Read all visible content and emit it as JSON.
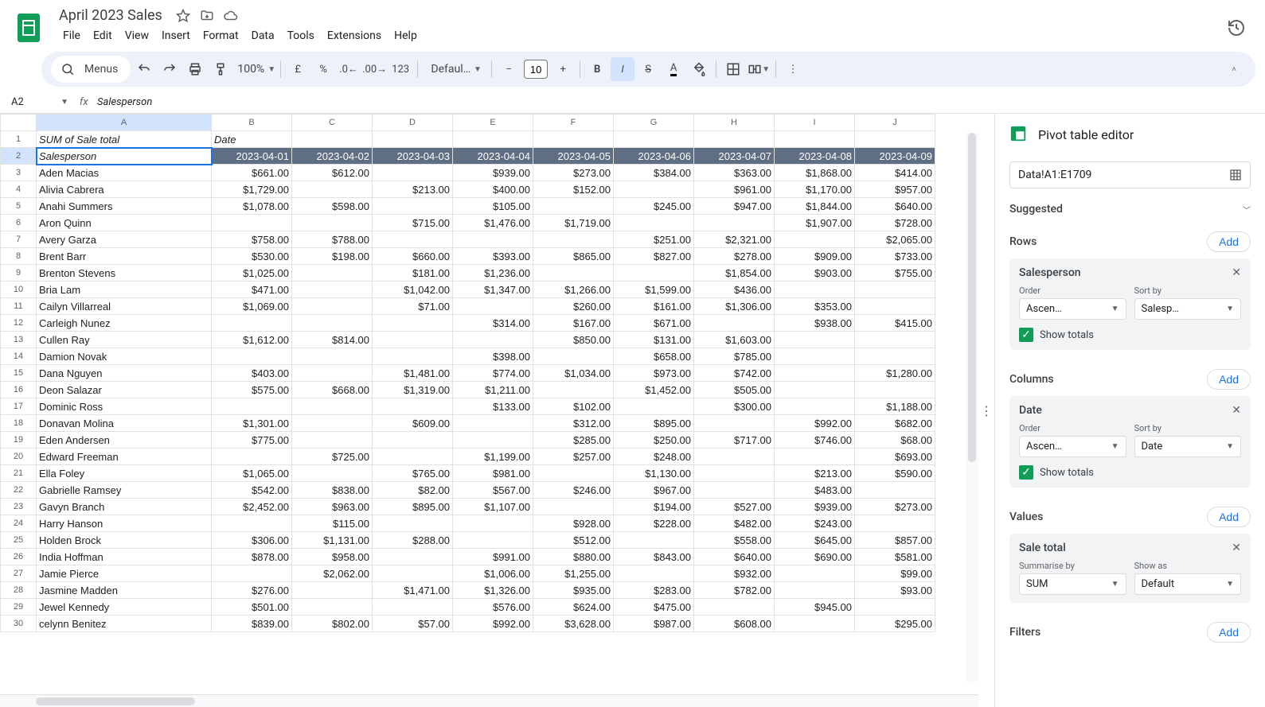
{
  "doc": {
    "title": "April 2023 Sales"
  },
  "menus": [
    "File",
    "Edit",
    "View",
    "Insert",
    "Format",
    "Data",
    "Tools",
    "Extensions",
    "Help"
  ],
  "toolbar": {
    "search": "Menus",
    "zoom": "100%",
    "font": "Defaul…",
    "fontsize": "10"
  },
  "namebox": "A2",
  "formula": "Salesperson",
  "columns": [
    "A",
    "B",
    "C",
    "D",
    "E",
    "F",
    "G",
    "H",
    "I",
    "J"
  ],
  "pivot_hdr": {
    "a1": "SUM of Sale total",
    "b1": "Date"
  },
  "row2_label": "Salesperson",
  "dates": [
    "2023-04-01",
    "2023-04-02",
    "2023-04-03",
    "2023-04-04",
    "2023-04-05",
    "2023-04-06",
    "2023-04-07",
    "2023-04-08",
    "2023-04-09"
  ],
  "rows": [
    {
      "n": "Aden Macias",
      "v": [
        "$661.00",
        "$612.00",
        "",
        "$939.00",
        "$273.00",
        "$384.00",
        "$363.00",
        "$1,868.00",
        "$414.00"
      ]
    },
    {
      "n": "Alivia Cabrera",
      "v": [
        "$1,729.00",
        "",
        "$213.00",
        "$400.00",
        "$152.00",
        "",
        "$961.00",
        "$1,170.00",
        "$957.00"
      ]
    },
    {
      "n": "Anahi Summers",
      "v": [
        "$1,078.00",
        "$598.00",
        "",
        "$105.00",
        "",
        "$245.00",
        "$947.00",
        "$1,844.00",
        "$640.00"
      ]
    },
    {
      "n": "Aron Quinn",
      "v": [
        "",
        "",
        "$715.00",
        "$1,476.00",
        "$1,719.00",
        "",
        "",
        "$1,907.00",
        "$728.00"
      ]
    },
    {
      "n": "Avery Garza",
      "v": [
        "$758.00",
        "$788.00",
        "",
        "",
        "",
        "$251.00",
        "$2,321.00",
        "",
        "$2,065.00"
      ]
    },
    {
      "n": "Brent Barr",
      "v": [
        "$530.00",
        "$198.00",
        "$660.00",
        "$393.00",
        "$865.00",
        "$827.00",
        "$278.00",
        "$909.00",
        "$733.00"
      ]
    },
    {
      "n": "Brenton Stevens",
      "v": [
        "$1,025.00",
        "",
        "$181.00",
        "$1,236.00",
        "",
        "",
        "$1,854.00",
        "$903.00",
        "$755.00"
      ]
    },
    {
      "n": "Bria Lam",
      "v": [
        "$471.00",
        "",
        "$1,042.00",
        "$1,347.00",
        "$1,266.00",
        "$1,599.00",
        "$436.00",
        "",
        ""
      ]
    },
    {
      "n": "Cailyn Villarreal",
      "v": [
        "$1,069.00",
        "",
        "$71.00",
        "",
        "$260.00",
        "$161.00",
        "$1,306.00",
        "$353.00",
        ""
      ]
    },
    {
      "n": "Carleigh Nunez",
      "v": [
        "",
        "",
        "",
        "$314.00",
        "$167.00",
        "$671.00",
        "",
        "$938.00",
        "$415.00"
      ]
    },
    {
      "n": "Cullen Ray",
      "v": [
        "$1,612.00",
        "$814.00",
        "",
        "",
        "$850.00",
        "$131.00",
        "$1,603.00",
        "",
        ""
      ]
    },
    {
      "n": "Damion Novak",
      "v": [
        "",
        "",
        "",
        "$398.00",
        "",
        "$658.00",
        "$785.00",
        "",
        ""
      ]
    },
    {
      "n": "Dana Nguyen",
      "v": [
        "$403.00",
        "",
        "$1,481.00",
        "$774.00",
        "$1,034.00",
        "$973.00",
        "$742.00",
        "",
        "$1,280.00"
      ]
    },
    {
      "n": "Deon Salazar",
      "v": [
        "$575.00",
        "$668.00",
        "$1,319.00",
        "$1,211.00",
        "",
        "$1,452.00",
        "$505.00",
        "",
        ""
      ]
    },
    {
      "n": "Dominic Ross",
      "v": [
        "",
        "",
        "",
        "$133.00",
        "$102.00",
        "",
        "$300.00",
        "",
        "$1,188.00"
      ]
    },
    {
      "n": "Donavan Molina",
      "v": [
        "$1,301.00",
        "",
        "$609.00",
        "",
        "$312.00",
        "$895.00",
        "",
        "$992.00",
        "$682.00"
      ]
    },
    {
      "n": "Eden Andersen",
      "v": [
        "$775.00",
        "",
        "",
        "",
        "$285.00",
        "$250.00",
        "$717.00",
        "$746.00",
        "$68.00"
      ]
    },
    {
      "n": "Edward Freeman",
      "v": [
        "",
        "$725.00",
        "",
        "$1,199.00",
        "$257.00",
        "$248.00",
        "",
        "",
        "$693.00"
      ]
    },
    {
      "n": "Ella Foley",
      "v": [
        "$1,065.00",
        "",
        "$765.00",
        "$981.00",
        "",
        "$1,130.00",
        "",
        "$213.00",
        "$590.00"
      ]
    },
    {
      "n": "Gabrielle Ramsey",
      "v": [
        "$542.00",
        "$838.00",
        "$82.00",
        "$567.00",
        "$246.00",
        "$967.00",
        "",
        "$483.00",
        ""
      ]
    },
    {
      "n": "Gavyn Branch",
      "v": [
        "$2,452.00",
        "$963.00",
        "$895.00",
        "$1,107.00",
        "",
        "$194.00",
        "$527.00",
        "$939.00",
        "$273.00"
      ]
    },
    {
      "n": "Harry Hanson",
      "v": [
        "",
        "$115.00",
        "",
        "",
        "$928.00",
        "$228.00",
        "$482.00",
        "$243.00",
        ""
      ]
    },
    {
      "n": "Holden Brock",
      "v": [
        "$306.00",
        "$1,131.00",
        "$288.00",
        "",
        "$512.00",
        "",
        "$558.00",
        "$645.00",
        "$857.00"
      ]
    },
    {
      "n": "India Hoffman",
      "v": [
        "$878.00",
        "$958.00",
        "",
        "$991.00",
        "$880.00",
        "$843.00",
        "$640.00",
        "$690.00",
        "$581.00"
      ]
    },
    {
      "n": "Jamie Pierce",
      "v": [
        "",
        "$2,062.00",
        "",
        "$1,006.00",
        "$1,255.00",
        "",
        "$932.00",
        "",
        "$99.00"
      ]
    },
    {
      "n": "Jasmine Madden",
      "v": [
        "$276.00",
        "",
        "$1,471.00",
        "$1,326.00",
        "$935.00",
        "$283.00",
        "$782.00",
        "",
        "$93.00"
      ]
    },
    {
      "n": "Jewel Kennedy",
      "v": [
        "$501.00",
        "",
        "",
        "$576.00",
        "$624.00",
        "$475.00",
        "",
        "$945.00",
        ""
      ]
    },
    {
      "n": "celynn Benitez",
      "v": [
        "$839.00",
        "$802.00",
        "$57.00",
        "$992.00",
        "$3,628.00",
        "$987.00",
        "$608.00",
        "",
        "$295.00"
      ]
    }
  ],
  "panel": {
    "title": "Pivot table editor",
    "range": "Data!A1:E1709",
    "suggested": "Suggested",
    "rows_label": "Rows",
    "cols_label": "Columns",
    "values_label": "Values",
    "filters_label": "Filters",
    "add": "Add",
    "row_card": {
      "title": "Salesperson",
      "order_label": "Order",
      "order": "Ascen…",
      "sort_label": "Sort by",
      "sort": "Salesp…",
      "totals": "Show totals"
    },
    "col_card": {
      "title": "Date",
      "order_label": "Order",
      "order": "Ascen…",
      "sort_label": "Sort by",
      "sort": "Date",
      "totals": "Show totals"
    },
    "val_card": {
      "title": "Sale total",
      "sum_label": "Summarise by",
      "sum": "SUM",
      "show_label": "Show as",
      "show": "Default"
    }
  }
}
